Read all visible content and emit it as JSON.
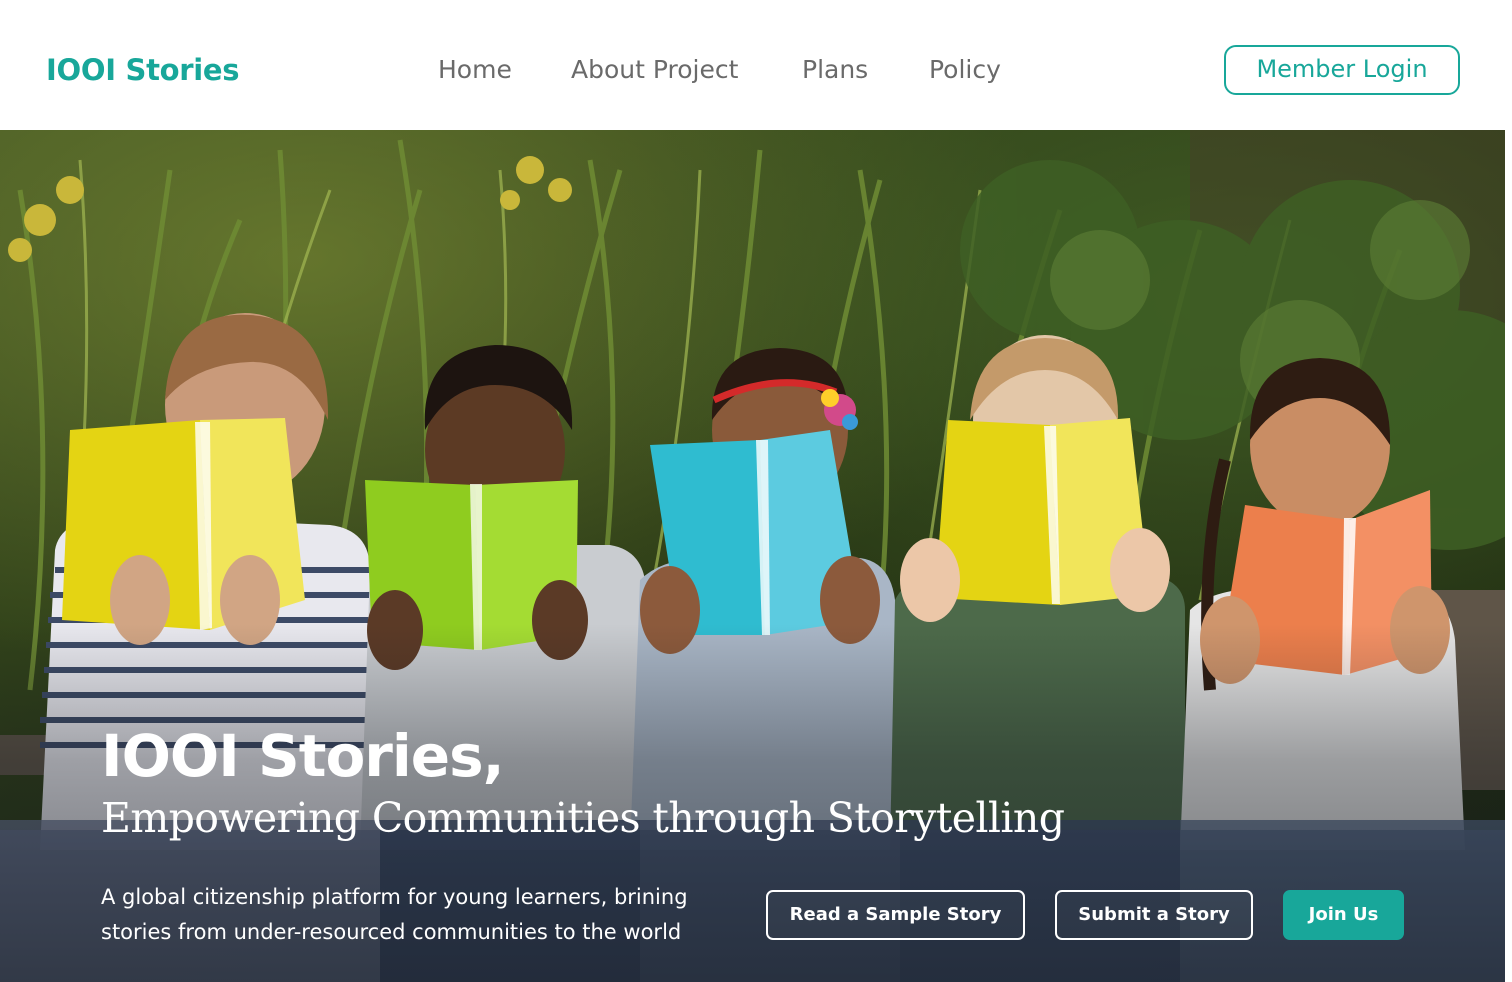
{
  "header": {
    "brand": "IOOI Stories",
    "nav": [
      {
        "label": "Home"
      },
      {
        "label": "About Project"
      },
      {
        "label": "Plans"
      },
      {
        "label": "Policy"
      }
    ],
    "login_label": "Member Login"
  },
  "hero": {
    "title": "IOOI Stories,",
    "subtitle": "Empowering Communities through Storytelling",
    "description_line1": "A global citizenship platform for young learners, brining",
    "description_line2": "stories from under-resourced communities to the world",
    "buttons": {
      "sample_story": "Read a Sample Story",
      "submit_story": "Submit a Story",
      "join": "Join Us"
    }
  },
  "colors": {
    "accent": "#18a79a",
    "nav_text": "#6a6a6a",
    "hero_text": "#ffffff",
    "book_yellow": "#e4d413",
    "book_green": "#8fcc1f",
    "book_blue": "#2fbcd0",
    "book_orange": "#ec7f4c"
  },
  "icons": {
    "hero_image": "children-reading-books-photo"
  }
}
